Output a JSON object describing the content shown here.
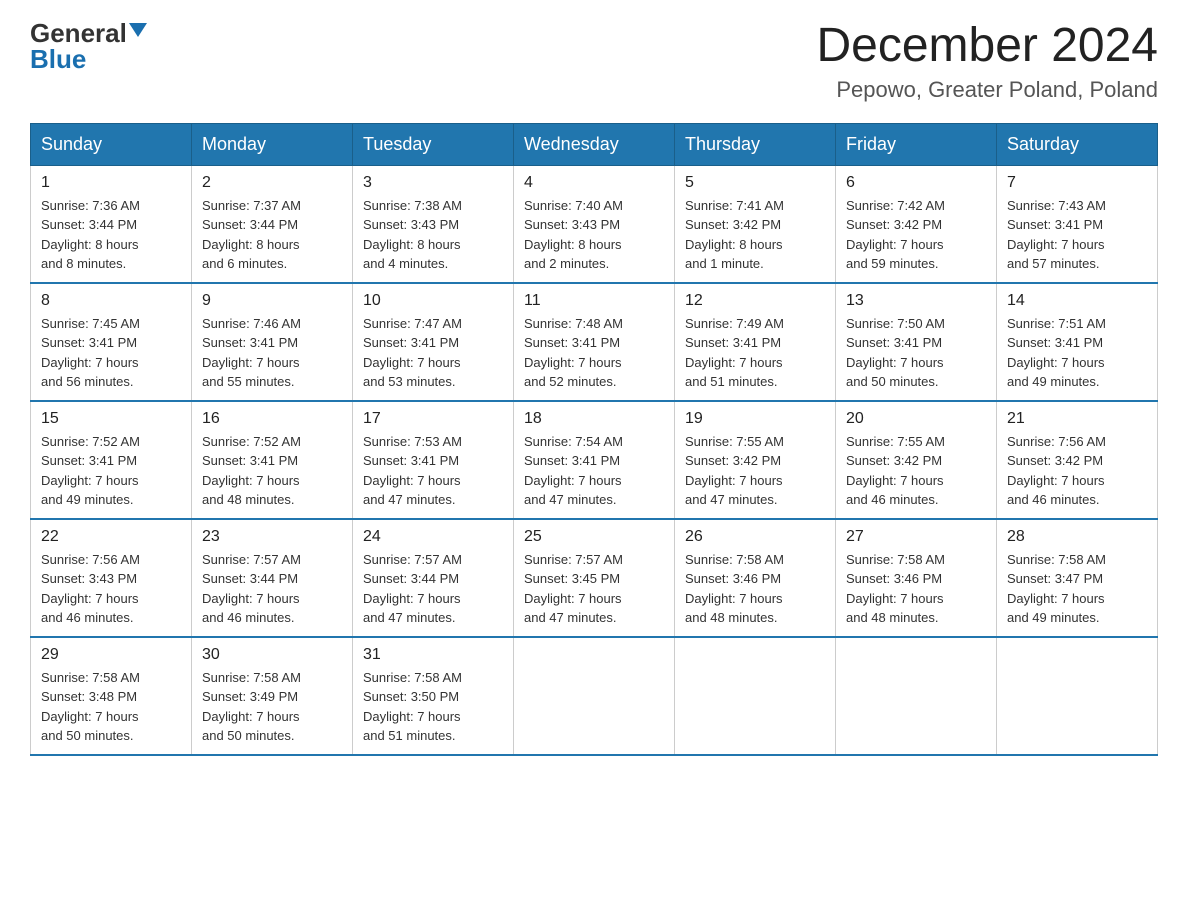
{
  "logo": {
    "general": "General",
    "blue": "Blue",
    "triangle": "▼"
  },
  "title": "December 2024",
  "subtitle": "Pepowo, Greater Poland, Poland",
  "days_of_week": [
    "Sunday",
    "Monday",
    "Tuesday",
    "Wednesday",
    "Thursday",
    "Friday",
    "Saturday"
  ],
  "weeks": [
    [
      {
        "num": "1",
        "info": "Sunrise: 7:36 AM\nSunset: 3:44 PM\nDaylight: 8 hours\nand 8 minutes."
      },
      {
        "num": "2",
        "info": "Sunrise: 7:37 AM\nSunset: 3:44 PM\nDaylight: 8 hours\nand 6 minutes."
      },
      {
        "num": "3",
        "info": "Sunrise: 7:38 AM\nSunset: 3:43 PM\nDaylight: 8 hours\nand 4 minutes."
      },
      {
        "num": "4",
        "info": "Sunrise: 7:40 AM\nSunset: 3:43 PM\nDaylight: 8 hours\nand 2 minutes."
      },
      {
        "num": "5",
        "info": "Sunrise: 7:41 AM\nSunset: 3:42 PM\nDaylight: 8 hours\nand 1 minute."
      },
      {
        "num": "6",
        "info": "Sunrise: 7:42 AM\nSunset: 3:42 PM\nDaylight: 7 hours\nand 59 minutes."
      },
      {
        "num": "7",
        "info": "Sunrise: 7:43 AM\nSunset: 3:41 PM\nDaylight: 7 hours\nand 57 minutes."
      }
    ],
    [
      {
        "num": "8",
        "info": "Sunrise: 7:45 AM\nSunset: 3:41 PM\nDaylight: 7 hours\nand 56 minutes."
      },
      {
        "num": "9",
        "info": "Sunrise: 7:46 AM\nSunset: 3:41 PM\nDaylight: 7 hours\nand 55 minutes."
      },
      {
        "num": "10",
        "info": "Sunrise: 7:47 AM\nSunset: 3:41 PM\nDaylight: 7 hours\nand 53 minutes."
      },
      {
        "num": "11",
        "info": "Sunrise: 7:48 AM\nSunset: 3:41 PM\nDaylight: 7 hours\nand 52 minutes."
      },
      {
        "num": "12",
        "info": "Sunrise: 7:49 AM\nSunset: 3:41 PM\nDaylight: 7 hours\nand 51 minutes."
      },
      {
        "num": "13",
        "info": "Sunrise: 7:50 AM\nSunset: 3:41 PM\nDaylight: 7 hours\nand 50 minutes."
      },
      {
        "num": "14",
        "info": "Sunrise: 7:51 AM\nSunset: 3:41 PM\nDaylight: 7 hours\nand 49 minutes."
      }
    ],
    [
      {
        "num": "15",
        "info": "Sunrise: 7:52 AM\nSunset: 3:41 PM\nDaylight: 7 hours\nand 49 minutes."
      },
      {
        "num": "16",
        "info": "Sunrise: 7:52 AM\nSunset: 3:41 PM\nDaylight: 7 hours\nand 48 minutes."
      },
      {
        "num": "17",
        "info": "Sunrise: 7:53 AM\nSunset: 3:41 PM\nDaylight: 7 hours\nand 47 minutes."
      },
      {
        "num": "18",
        "info": "Sunrise: 7:54 AM\nSunset: 3:41 PM\nDaylight: 7 hours\nand 47 minutes."
      },
      {
        "num": "19",
        "info": "Sunrise: 7:55 AM\nSunset: 3:42 PM\nDaylight: 7 hours\nand 47 minutes."
      },
      {
        "num": "20",
        "info": "Sunrise: 7:55 AM\nSunset: 3:42 PM\nDaylight: 7 hours\nand 46 minutes."
      },
      {
        "num": "21",
        "info": "Sunrise: 7:56 AM\nSunset: 3:42 PM\nDaylight: 7 hours\nand 46 minutes."
      }
    ],
    [
      {
        "num": "22",
        "info": "Sunrise: 7:56 AM\nSunset: 3:43 PM\nDaylight: 7 hours\nand 46 minutes."
      },
      {
        "num": "23",
        "info": "Sunrise: 7:57 AM\nSunset: 3:44 PM\nDaylight: 7 hours\nand 46 minutes."
      },
      {
        "num": "24",
        "info": "Sunrise: 7:57 AM\nSunset: 3:44 PM\nDaylight: 7 hours\nand 47 minutes."
      },
      {
        "num": "25",
        "info": "Sunrise: 7:57 AM\nSunset: 3:45 PM\nDaylight: 7 hours\nand 47 minutes."
      },
      {
        "num": "26",
        "info": "Sunrise: 7:58 AM\nSunset: 3:46 PM\nDaylight: 7 hours\nand 48 minutes."
      },
      {
        "num": "27",
        "info": "Sunrise: 7:58 AM\nSunset: 3:46 PM\nDaylight: 7 hours\nand 48 minutes."
      },
      {
        "num": "28",
        "info": "Sunrise: 7:58 AM\nSunset: 3:47 PM\nDaylight: 7 hours\nand 49 minutes."
      }
    ],
    [
      {
        "num": "29",
        "info": "Sunrise: 7:58 AM\nSunset: 3:48 PM\nDaylight: 7 hours\nand 50 minutes."
      },
      {
        "num": "30",
        "info": "Sunrise: 7:58 AM\nSunset: 3:49 PM\nDaylight: 7 hours\nand 50 minutes."
      },
      {
        "num": "31",
        "info": "Sunrise: 7:58 AM\nSunset: 3:50 PM\nDaylight: 7 hours\nand 51 minutes."
      },
      null,
      null,
      null,
      null
    ]
  ]
}
